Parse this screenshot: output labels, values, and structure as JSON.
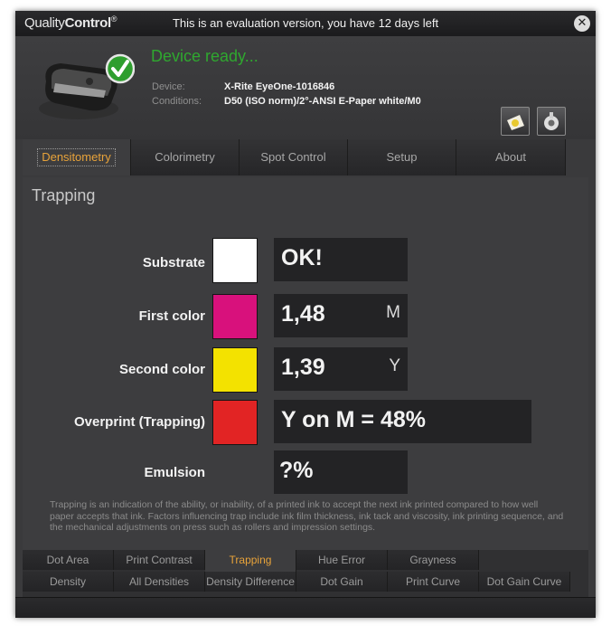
{
  "titlebar": {
    "brand_light": "Quality",
    "brand_bold": "Control",
    "brand_mark": "®",
    "message": "This is an evaluation version, you have 12 days left"
  },
  "device": {
    "status": "Device ready...",
    "device_label": "Device:",
    "device_value": "X-Rite EyeOne-1016846",
    "conditions_label": "Conditions:",
    "conditions_value": "D50 (ISO norm)/2°-ANSI E-Paper white/M0"
  },
  "main_tabs": [
    {
      "label": "Densitometry",
      "active": true
    },
    {
      "label": "Colorimetry",
      "active": false
    },
    {
      "label": "Spot Control",
      "active": false
    },
    {
      "label": "Setup",
      "active": false
    },
    {
      "label": "About",
      "active": false
    }
  ],
  "trapping": {
    "title": "Trapping",
    "rows": {
      "substrate": {
        "label": "Substrate",
        "color": "#ffffff",
        "value": "OK!"
      },
      "first": {
        "label": "First color",
        "color": "#d8117c",
        "value": "1,48",
        "letter": "M"
      },
      "second": {
        "label": "Second color",
        "color": "#f3e200",
        "value": "1,39",
        "letter": "Y"
      },
      "overprint": {
        "label": "Overprint (Trapping)",
        "color": "#e22424",
        "value": "Y on M = 48%"
      },
      "emulsion": {
        "label": "Emulsion",
        "value": "?%"
      }
    },
    "description": "Trapping is an indication of the ability, or inability, of a printed ink to accept the next ink printed compared to how well paper accepts that ink. Factors influencing trap include ink film thickness, ink tack and viscosity, ink printing sequence, and the mechanical adjustments on press such as rollers and impression settings."
  },
  "sub_tabs_top": [
    {
      "label": "Dot Area",
      "active": false
    },
    {
      "label": "Print Contrast",
      "active": false
    },
    {
      "label": "Trapping",
      "active": true
    },
    {
      "label": "Hue Error",
      "active": false
    },
    {
      "label": "Grayness",
      "active": false
    }
  ],
  "sub_tabs_bottom": [
    {
      "label": "Density"
    },
    {
      "label": "All Densities"
    },
    {
      "label": "Density Difference"
    },
    {
      "label": "Dot Gain"
    },
    {
      "label": "Print Curve"
    },
    {
      "label": "Dot Gain Curve"
    }
  ]
}
